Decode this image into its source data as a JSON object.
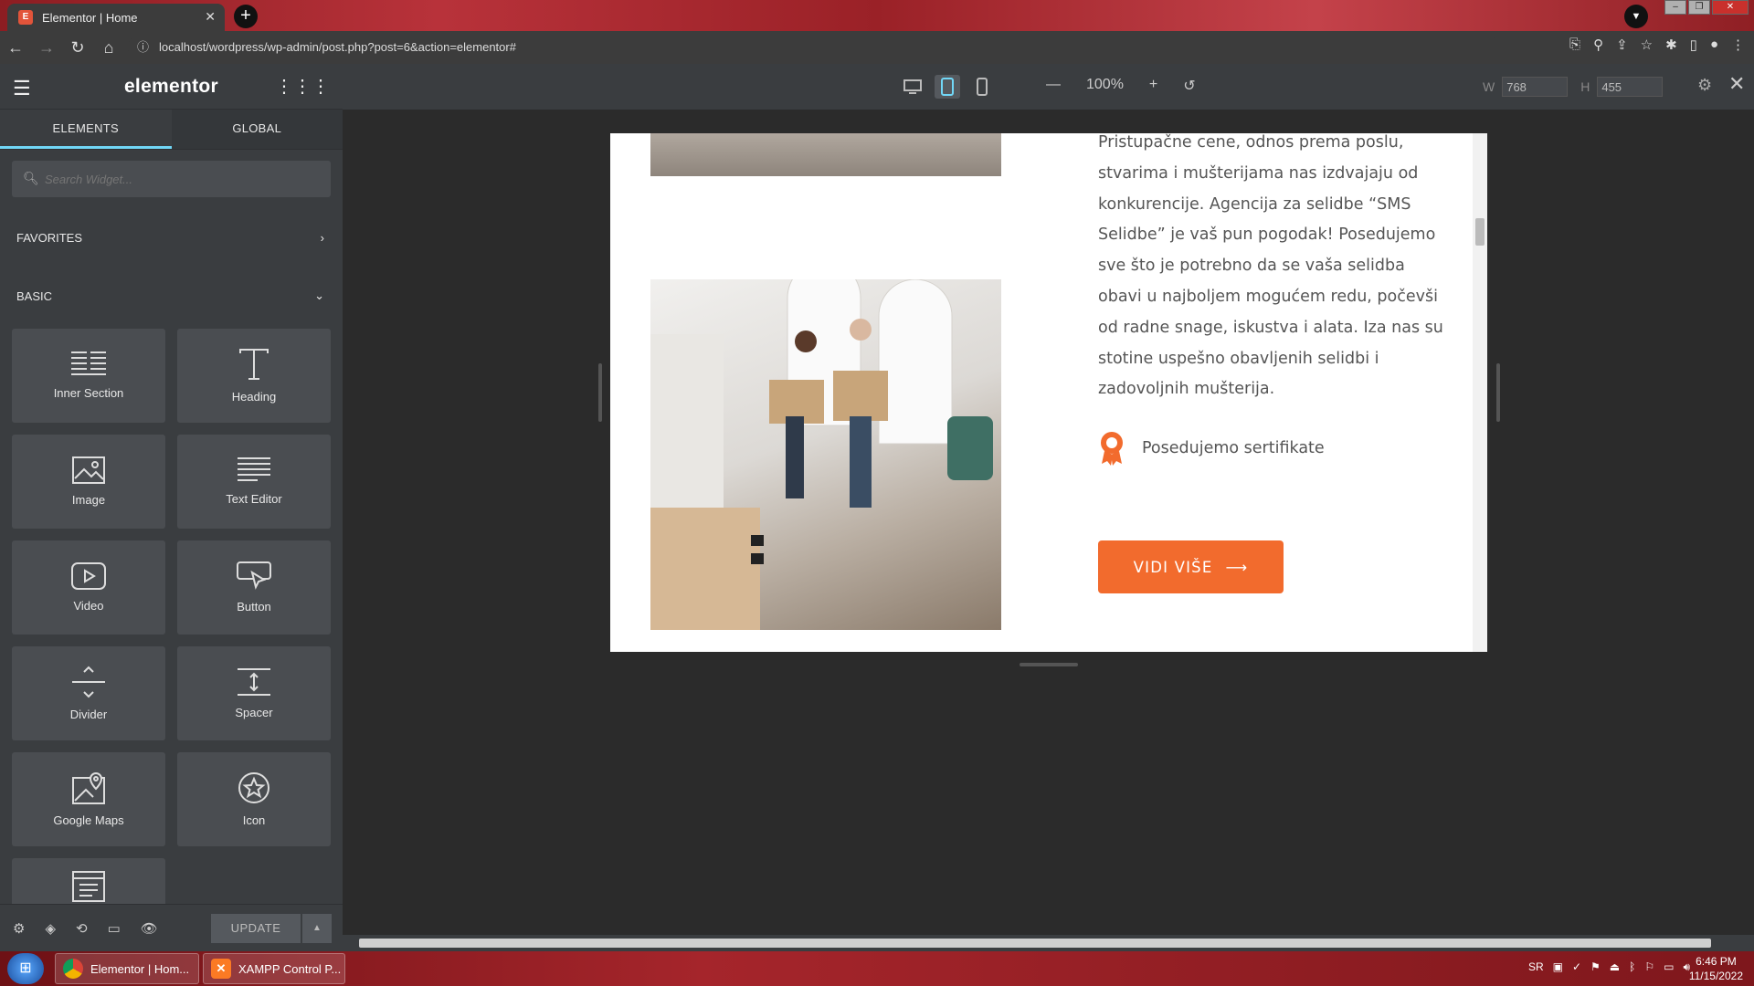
{
  "browser": {
    "tab_title": "Elementor | Home",
    "url": "localhost/wordpress/wp-admin/post.php?post=6&action=elementor#"
  },
  "panel": {
    "logo": "elementor",
    "tabs": [
      "ELEMENTS",
      "GLOBAL"
    ],
    "search_placeholder": "Search Widget...",
    "sections": {
      "favorites": "FAVORITES",
      "basic": "BASIC"
    },
    "widgets": [
      "Inner Section",
      "Heading",
      "Image",
      "Text Editor",
      "Video",
      "Button",
      "Divider",
      "Spacer",
      "Google Maps",
      "Icon"
    ],
    "update_label": "UPDATE"
  },
  "topbar": {
    "zoom": "100%",
    "w_label": "W",
    "h_label": "H",
    "width_value": "768",
    "height_value": "455"
  },
  "preview": {
    "paragraph": "Pristupačne cene, odnos prema poslu, stvarima i mušterijama nas izdvajaju od konkurencije. Agencija za selidbe “SMS Selidbe” je vaš pun pogodak! Posedujemo sve što je potrebno da se vaša selidba obavi u najboljem mogućem redu, počevši od radne snage, iskustva i alata. Iza nas su stotine uspešno obavljenih selidbi i zadovoljnih mušterija.",
    "certificate": "Posedujemo sertifikate",
    "cta": "VIDI VIŠE",
    "accent": "#f26b2d"
  },
  "taskbar": {
    "items": [
      "Elementor | Hom...",
      "XAMPP Control P..."
    ],
    "lang": "SR",
    "time": "6:46 PM",
    "date": "11/15/2022"
  }
}
